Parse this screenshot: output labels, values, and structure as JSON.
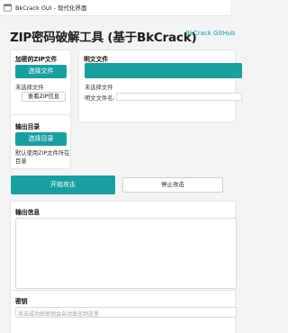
{
  "window": {
    "title": "BkCrack GUI - 现代化界面"
  },
  "header": {
    "title": "ZIP密码破解工具 (基于BkCrack)",
    "github_link": "BkCrack GitHub"
  },
  "encrypted_zip": {
    "title": "加密的ZIP文件",
    "select_button": "选择文件",
    "status": "未选择文件",
    "info_button": "查看ZIP信息"
  },
  "plaintext": {
    "title": "明文文件",
    "status": "未选择文件",
    "filename_label": "明文文件名:",
    "filename_value": ""
  },
  "output_dir": {
    "title": "输出目录",
    "select_button": "选择目录",
    "note": "默认使用ZIP文件所在目录"
  },
  "actions": {
    "start_button": "开始攻击",
    "stop_button": "停止攻击"
  },
  "output": {
    "title": "输出信息",
    "content": ""
  },
  "key": {
    "title": "密钥",
    "placeholder": "攻击成功后密钥会自动填充到这里"
  },
  "colors": {
    "accent": "#1a9fa1",
    "link": "#13a0a0"
  }
}
